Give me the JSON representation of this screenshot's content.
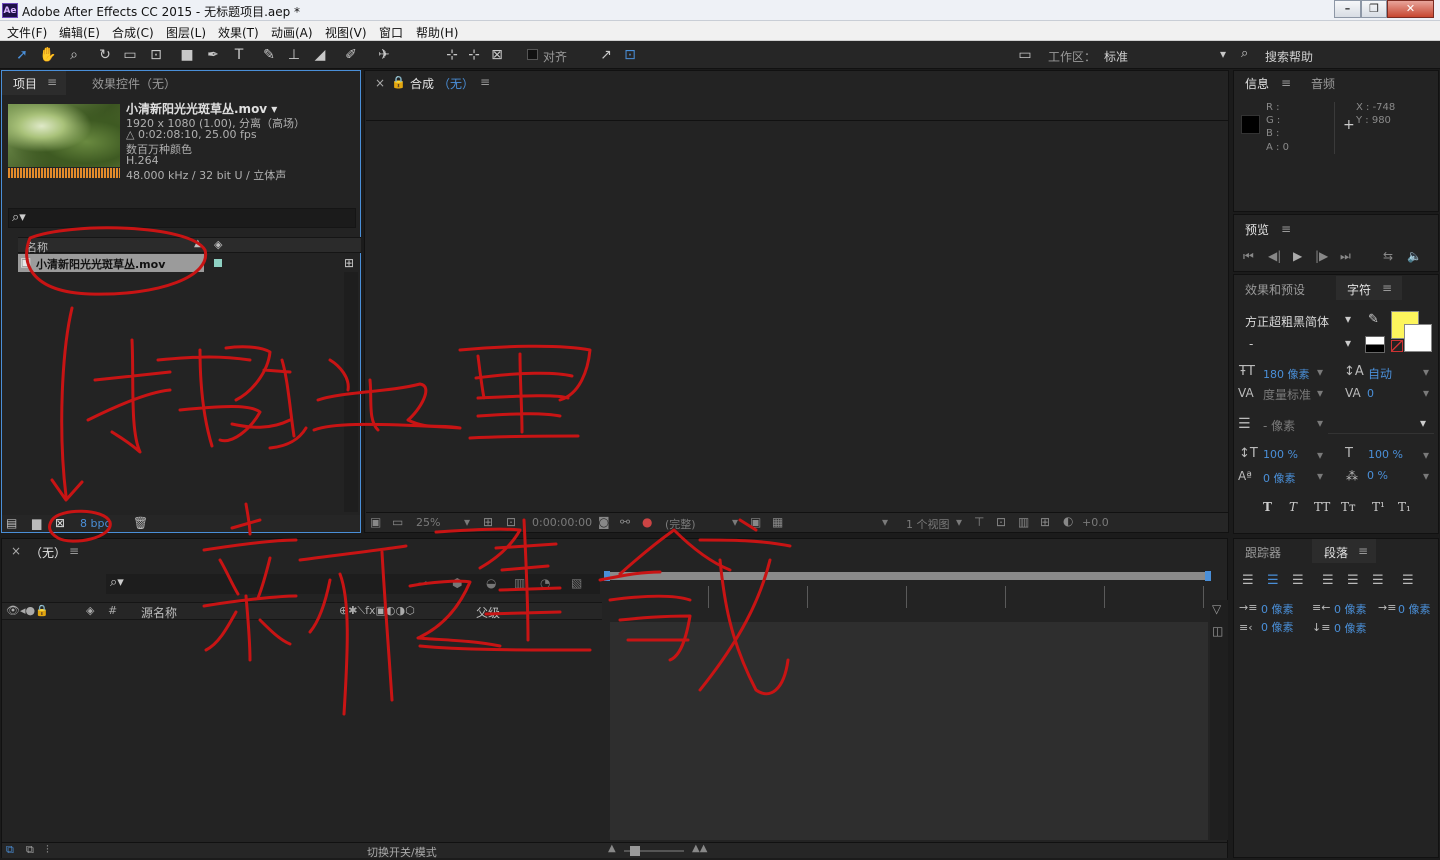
{
  "window": {
    "title": "Adobe After Effects CC 2015 - 无标题项目.aep *",
    "logo": "Ae"
  },
  "menus": [
    "文件(F)",
    "编辑(E)",
    "合成(C)",
    "图层(L)",
    "效果(T)",
    "动画(A)",
    "视图(V)",
    "窗口",
    "帮助(H)"
  ],
  "toolbar": {
    "snap_label": "对齐",
    "workspace_label": "工作区：",
    "workspace_value": "标准",
    "search_help": "搜索帮助"
  },
  "project": {
    "tab": "项目",
    "effects_tab": "效果控件（无）",
    "file_title": "小清新阳光光斑草丛.mov ▾",
    "info": [
      "1920 x 1080 (1.00), 分离（高场）",
      "△ 0:02:08:10, 25.00 fps",
      "数百万种颜色",
      "H.264",
      "48.000 kHz / 32 bit U / 立体声"
    ],
    "col_name": "名称",
    "item_name": "小清新阳光光斑草丛.mov",
    "bpc": "8 bpc"
  },
  "composition": {
    "tab_prefix": "合成",
    "tab_value": "（无）",
    "zoom": "25%",
    "timecode": "0:00:00:00",
    "quality": "(完整)",
    "views": "1 个视图",
    "exposure": "+0.0"
  },
  "timeline": {
    "tab": "（无）",
    "col_source": "源名称",
    "col_parent": "父级",
    "col_hash": "#",
    "toggle_label": "切换开关/模式"
  },
  "info_panel": {
    "tab": "信息",
    "audio_tab": "音频",
    "r": "R :",
    "g": "G :",
    "b": "B :",
    "a": "A : 0",
    "x": "X : -748",
    "y": "Y : 980"
  },
  "preview": {
    "tab": "预览"
  },
  "character": {
    "effects_tab": "效果和预设",
    "tab": "字符",
    "font": "方正超粗黑简体",
    "style": "-",
    "size": "180 像素",
    "leading": "自动",
    "kerning": "度量标准",
    "tracking": "0",
    "stroke": "- 像素",
    "vscale": "100 %",
    "hscale": "100 %",
    "baseline": "0 像素",
    "tsume": "0 %",
    "styles": [
      "T",
      "T",
      "TT",
      "Tт",
      "T¹",
      "T₁"
    ],
    "fill_color": "#fdf55d"
  },
  "paragraph": {
    "tracker_tab": "跟踪器",
    "tab": "段落",
    "indents": [
      "0 像素",
      "0 像素",
      "0 像素",
      "0 像素",
      "0 像素"
    ]
  },
  "annotations": {
    "drag_here": "拖到这里",
    "new_comp": "新建合成",
    "color": "#c81414"
  }
}
